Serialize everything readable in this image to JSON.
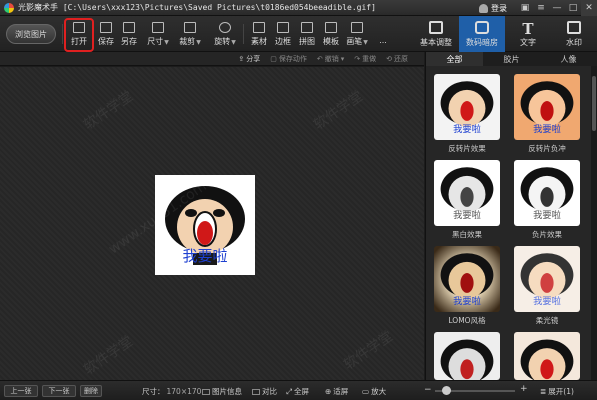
{
  "window": {
    "app_name": "光影魔术手",
    "path": "[C:\\Users\\xxx123\\Pictures\\Saved Pictures\\t0186ed054beeadible.gif]",
    "login_label": "登录"
  },
  "toolbar": {
    "browse_label": "浏览图片",
    "tools": [
      {
        "label": "打开",
        "icon": "open-icon"
      },
      {
        "label": "保存",
        "icon": "save-icon"
      },
      {
        "label": "另存",
        "icon": "save-as-icon"
      },
      {
        "label": "尺寸",
        "icon": "resize-icon"
      },
      {
        "label": "裁剪",
        "icon": "crop-icon"
      },
      {
        "label": "旋转",
        "icon": "rotate-icon"
      },
      {
        "label": "素材",
        "icon": "material-icon"
      },
      {
        "label": "边框",
        "icon": "border-icon"
      },
      {
        "label": "拼图",
        "icon": "collage-icon"
      },
      {
        "label": "模板",
        "icon": "template-icon"
      },
      {
        "label": "画笔",
        "icon": "brush-icon"
      },
      {
        "label": "...",
        "icon": "more-icon"
      }
    ],
    "right_tabs": [
      {
        "label": "基本调整",
        "icon": "adjust-icon"
      },
      {
        "label": "数码暗房",
        "icon": "darkroom-icon"
      },
      {
        "label": "文字",
        "icon": "text-icon"
      },
      {
        "label": "水印",
        "icon": "watermark-icon"
      }
    ],
    "active_right_tab": "数码暗房"
  },
  "subbar": {
    "share": "分享",
    "save_action": "保存动作",
    "undo": "撤销",
    "redo": "重做",
    "restore": "还原"
  },
  "panel": {
    "tabs": [
      "全部",
      "胶片",
      "人像"
    ],
    "effects": [
      "反转片效果",
      "反转片负冲",
      "黑白效果",
      "负片效果",
      "LOMO风格",
      "柔光镜",
      "",
      ""
    ],
    "thumb_text": "我要啦"
  },
  "photo": {
    "caption": "我要啦"
  },
  "status": {
    "prev": "上一张",
    "next": "下一张",
    "delete": "删除",
    "size_label": "尺寸：",
    "size_value": "170×170",
    "info": "图片信息",
    "compare": "对比",
    "fullscreen": "全屏",
    "fit": "适屏",
    "zoom": "放大",
    "expand": "展开(1)",
    "zoom_fraction": 0.1
  },
  "watermark": "软件学堂",
  "watermark_url": "www.xue51.com"
}
